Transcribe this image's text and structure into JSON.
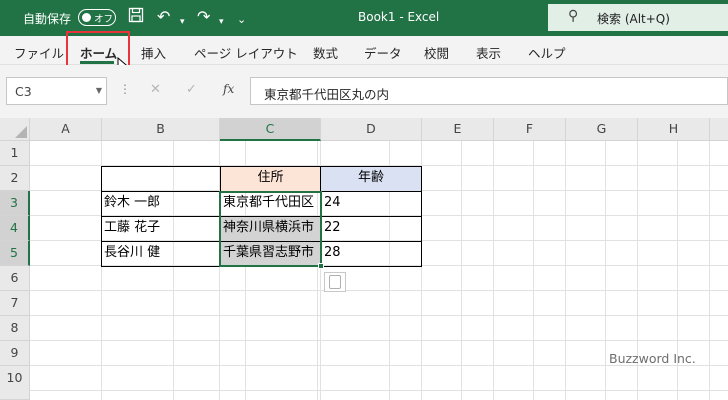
{
  "titlebar": {
    "autosave_label": "自動保存",
    "autosave_state": "オフ",
    "title": "Book1  -  Excel",
    "search_label": "検索 (Alt+Q)"
  },
  "ribbon": {
    "tabs": [
      "ファイル",
      "ホーム",
      "挿入",
      "ページ レイアウト",
      "数式",
      "データ",
      "校閲",
      "表示",
      "ヘルプ"
    ],
    "active_tab": "ホーム"
  },
  "formula_bar": {
    "name_box": "C3",
    "fx": "fx",
    "content": "東京都千代田区丸の内"
  },
  "columns": [
    "A",
    "B",
    "C",
    "D",
    "E",
    "F",
    "G",
    "H"
  ],
  "rows": [
    "1",
    "2",
    "3",
    "4",
    "5",
    "6",
    "7",
    "8",
    "9",
    "10"
  ],
  "table": {
    "header_address": "住所",
    "header_age": "年齢",
    "names": [
      "鈴木 一郎",
      "工藤 花子",
      "長谷川 健"
    ],
    "addresses": [
      "東京都千代田区",
      "神奈川県横浜市",
      "千葉県習志野市"
    ],
    "ages": [
      "24",
      "22",
      "28"
    ]
  },
  "watermark": "Buzzword Inc.",
  "colors": {
    "excel_green": "#217346",
    "header_address_bg": "#fce4d6",
    "header_age_bg": "#d9e1f2",
    "highlight_box": "#e8343a"
  }
}
